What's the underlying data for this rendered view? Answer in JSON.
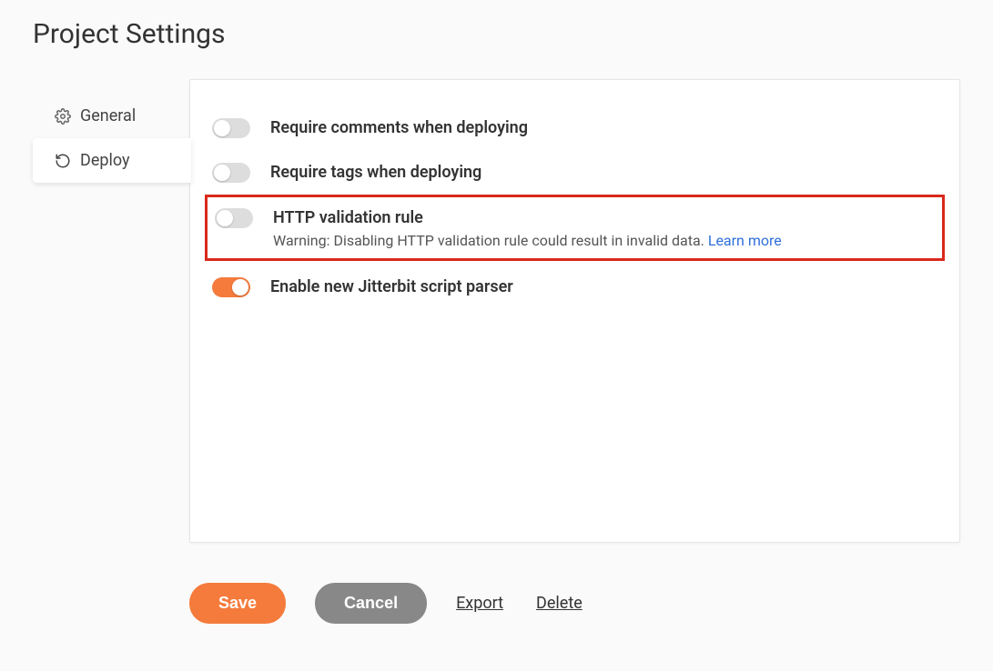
{
  "title": "Project Settings",
  "sidebar": {
    "tabs": [
      {
        "label": "General",
        "active": false
      },
      {
        "label": "Deploy",
        "active": true
      }
    ]
  },
  "settings": {
    "requireComments": {
      "label": "Require comments when deploying",
      "on": false
    },
    "requireTags": {
      "label": "Require tags when deploying",
      "on": false
    },
    "httpValidation": {
      "label": "HTTP validation rule",
      "desc": "Warning: Disabling HTTP validation rule could result in invalid data. ",
      "learnMore": "Learn more",
      "on": false
    },
    "scriptParser": {
      "label": "Enable new Jitterbit script parser",
      "on": true
    }
  },
  "actions": {
    "save": "Save",
    "cancel": "Cancel",
    "export": "Export",
    "delete": "Delete"
  }
}
